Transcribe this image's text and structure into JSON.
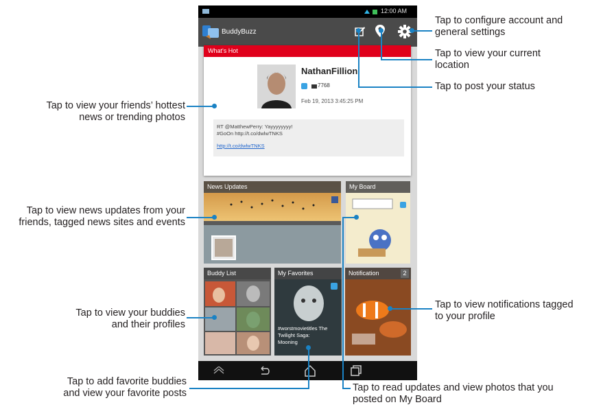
{
  "app": {
    "name": "BuddyBuzz",
    "status_time": "12:00 AM"
  },
  "whats_hot": {
    "label": "What's Hot",
    "user_name": "NathanFillion",
    "count": "7768",
    "timestamp": "Feb 19, 2013 3:45:25 PM",
    "post_line1": "RT @MatthewPerry: Yayyyyyyyy!",
    "post_line2": "#GoOn http://t.co/dwlwTNKS",
    "link": "http://t.co/dwlwTNKS"
  },
  "tiles": {
    "news_updates": "News Updates",
    "my_board": "My Board",
    "buddy_list": "Buddy List",
    "my_favorites": "My Favorites",
    "notification": "Notification",
    "notification_badge": "2",
    "favorite_caption_1": "#worstmovietitles The",
    "favorite_caption_2": "Twilight Saga:",
    "favorite_caption_3": "Mooning"
  },
  "annotations": {
    "settings_1": "Tap to configure account and",
    "settings_2": "general settings",
    "location_1": "Tap to view your current",
    "location_2": "location",
    "post_status": "Tap to post your status",
    "hot_1": "Tap to view your friends’ hottest",
    "hot_2": "news or trending photos",
    "news_1": "Tap to view news updates from your",
    "news_2": "friends, tagged news sites and events",
    "buddies_1": "Tap to view your buddies",
    "buddies_2": "and their profiles",
    "notif_1": "Tap to view notifications tagged",
    "notif_2": "to your profile",
    "fav_1": "Tap to add favorite buddies",
    "fav_2": "and view your favorite posts",
    "board_1": "Tap to read updates and view photos that you",
    "board_2": "posted on My Board"
  },
  "colors": {
    "accent_line": "#1a82c4",
    "whats_hot_bar": "#e0001b",
    "twitter_blue": "#3aa3e3",
    "facebook_blue": "#3b5998"
  }
}
